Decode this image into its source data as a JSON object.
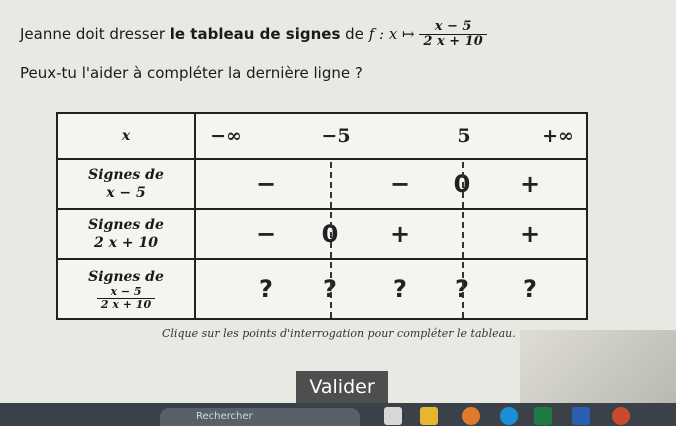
{
  "question": {
    "intro": "Jeanne doit dresser ",
    "bold": "le tableau de signes",
    "mid": " de ",
    "func": "f : x ↦",
    "num": "x − 5",
    "den": "2 x + 10",
    "line2": "Peux-tu l'aider à compléter la dernière ligne ?"
  },
  "table": {
    "header_label": "x",
    "x_values": [
      "−∞",
      "−5",
      "5",
      "+∞"
    ],
    "row1": {
      "label1": "Signes de",
      "label2": "x − 5",
      "cells": [
        "−",
        "−",
        "0",
        "+"
      ]
    },
    "row2": {
      "label1": "Signes de",
      "label2": "2 x + 10",
      "cells": [
        "−",
        "0",
        "+",
        "+"
      ]
    },
    "row3": {
      "label1": "Signes de",
      "frac_num": "x − 5",
      "frac_den": "2 x + 10",
      "cells": [
        "?",
        "?",
        "?",
        "?",
        "?"
      ]
    }
  },
  "caption": "Clique sur les points d'interrogation pour compléter le tableau.",
  "valider_label": "Valider",
  "taskbar": {
    "search_text": "Rechercher"
  }
}
